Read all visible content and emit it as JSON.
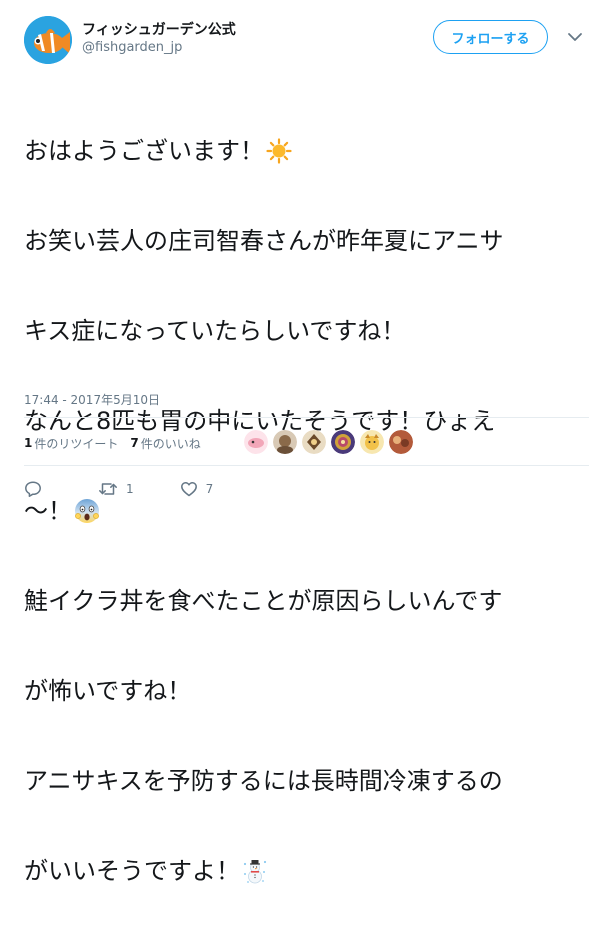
{
  "account": {
    "display_name": "フィッシュガーデン公式",
    "handle": "@fishgarden_jp",
    "follow_label": "フォローする"
  },
  "tweet": {
    "lines": [
      "おはようございます！",
      "お笑い芸人の庄司智春さんが昨年夏にアニサ",
      "キス症になっていたらしいですね！",
      "なんと8匹も胃の中にいたそうです！ひょえ",
      "〜！",
      "鮭イクラ丼を食べたことが原因らしいんです",
      "が怖いですね！",
      "アニサキスを予防するには長時間冷凍するの",
      "がいいそうですよ！"
    ],
    "emojis": [
      "sun-emoji",
      "screaming-face-emoji",
      "snowman-emoji"
    ],
    "timestamp": "17:44 - 2017年5月10日"
  },
  "stats": {
    "retweets_count": "1",
    "retweets_label": "件のリツイート",
    "likes_count": "7",
    "likes_label": "件のいいね"
  },
  "actions": {
    "reply_count": "",
    "retweet_count": "1",
    "like_count": "7"
  },
  "colors": {
    "accent": "#1da1f2",
    "muted": "#657786",
    "text": "#14171a",
    "divider": "#e6ecf0"
  }
}
